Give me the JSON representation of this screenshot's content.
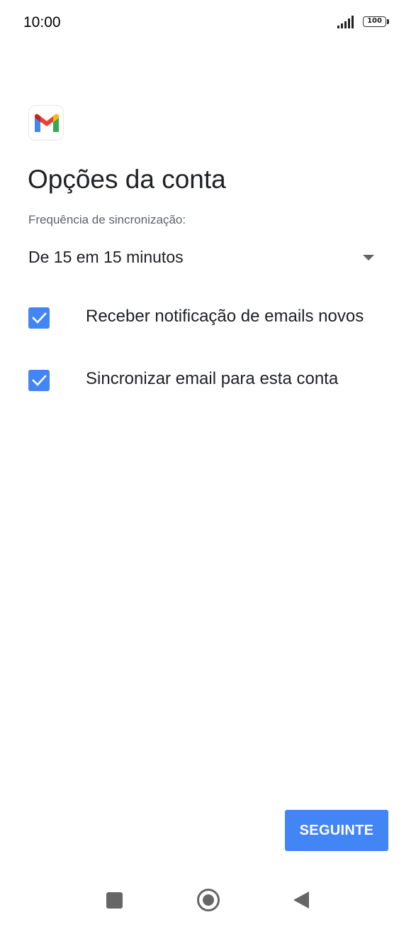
{
  "status_bar": {
    "time": "10:00",
    "battery_level": "100",
    "icons": [
      "signal-icon",
      "battery-icon"
    ]
  },
  "app": {
    "logo_icon": "gmail-logo-icon"
  },
  "page": {
    "title": "Opções da conta"
  },
  "sync": {
    "label": "Frequência de sincronização:",
    "selected_value": "De 15 em 15 minutos",
    "icon": "dropdown-arrow-icon"
  },
  "options": [
    {
      "label": "Receber notificação de emails novos",
      "checked": true
    },
    {
      "label": "Sincronizar email para esta conta",
      "checked": true
    }
  ],
  "actions": {
    "next_label": "SEGUINTE"
  },
  "nav_bar": {
    "icons": [
      "recents-icon",
      "home-icon",
      "back-icon"
    ]
  },
  "colors": {
    "accent": "#4285f4",
    "text_primary": "#202124",
    "text_secondary": "#5f6368",
    "nav_icons": "#666666"
  }
}
